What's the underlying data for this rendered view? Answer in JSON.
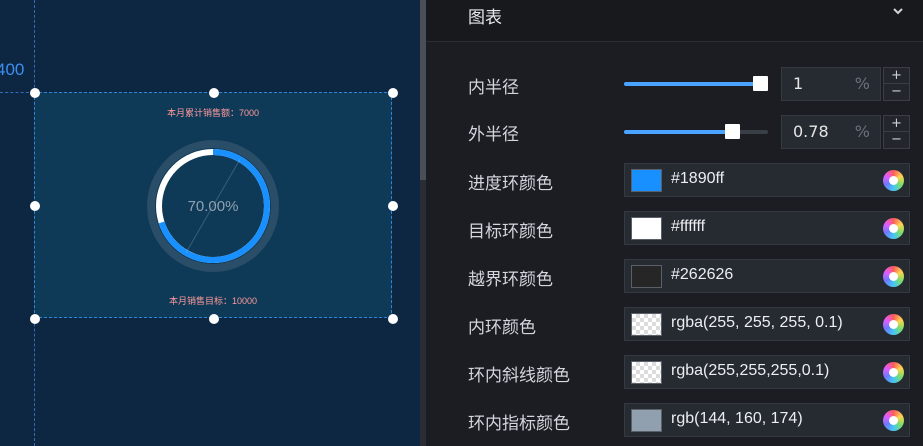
{
  "canvas": {
    "ruler_label": "400",
    "widget": {
      "top_label": "本月累计销售额：7000",
      "center_value": "70.00%",
      "bottom_label": "本月销售目标：10000",
      "progress": 0.7
    }
  },
  "panel": {
    "section_title": "图表",
    "collapse_icon": "chevron-down-icon",
    "inner_radius": {
      "label": "内半径",
      "value": "1",
      "unit": "%",
      "level": 1.0,
      "plus": "+",
      "minus": "−"
    },
    "outer_radius": {
      "label": "外半径",
      "value": "0.78",
      "unit": "%",
      "level": 0.78,
      "plus": "+",
      "minus": "−"
    },
    "colors": [
      {
        "label": "进度环颜色",
        "value": "#1890ff",
        "swatch": "#1890ff",
        "checker": false
      },
      {
        "label": "目标环颜色",
        "value": "#ffffff",
        "swatch": "#ffffff",
        "checker": false
      },
      {
        "label": "越界环颜色",
        "value": "#262626",
        "swatch": "#262626",
        "checker": false
      },
      {
        "label": "内环颜色",
        "value": "rgba(255, 255, 255, 0.1)",
        "swatch": "rgba(255,255,255,0.1)",
        "checker": true
      },
      {
        "label": "环内斜线颜色",
        "value": "rgba(255,255,255,0.1)",
        "swatch": "rgba(255,255,255,0.1)",
        "checker": true
      },
      {
        "label": "环内指标颜色",
        "value": "rgb(144, 160, 174)",
        "swatch": "rgb(144, 160, 174)",
        "checker": false
      }
    ]
  }
}
